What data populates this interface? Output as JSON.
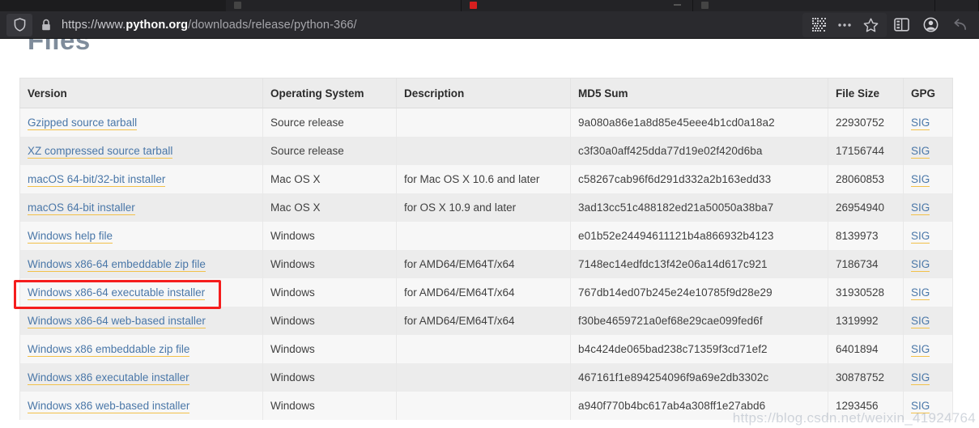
{
  "browser": {
    "url_full": "https://www.python.org/downloads/release/python-366/",
    "url_scheme": "https://www.",
    "url_host_bold": "python.org",
    "url_path": "/downloads/release/python-366/",
    "icons": {
      "shield": "shield-icon",
      "lock": "lock-icon",
      "qr": "qr-code-icon",
      "more": "ellipsis-icon",
      "bookmark": "star-icon",
      "sidebar": "sidebar-panel-icon",
      "account": "account-circle-icon",
      "back": "back-arrow-icon"
    }
  },
  "page": {
    "heading": "Files",
    "watermark": "https://blog.csdn.net/weixin_41924764"
  },
  "table": {
    "columns": [
      "Version",
      "Operating System",
      "Description",
      "MD5 Sum",
      "File Size",
      "GPG"
    ],
    "gpg_label": "SIG",
    "rows": [
      {
        "version": "Gzipped source tarball",
        "os": "Source release",
        "description": "",
        "md5": "9a080a86e1a8d85e45eee4b1cd0a18a2",
        "size": "22930752",
        "gpg": "SIG"
      },
      {
        "version": "XZ compressed source tarball",
        "os": "Source release",
        "description": "",
        "md5": "c3f30a0aff425dda77d19e02f420d6ba",
        "size": "17156744",
        "gpg": "SIG"
      },
      {
        "version": "macOS 64-bit/32-bit installer",
        "os": "Mac OS X",
        "description": "for Mac OS X 10.6 and later",
        "md5": "c58267cab96f6d291d332a2b163edd33",
        "size": "28060853",
        "gpg": "SIG"
      },
      {
        "version": "macOS 64-bit installer",
        "os": "Mac OS X",
        "description": "for OS X 10.9 and later",
        "md5": "3ad13cc51c488182ed21a50050a38ba7",
        "size": "26954940",
        "gpg": "SIG"
      },
      {
        "version": "Windows help file",
        "os": "Windows",
        "description": "",
        "md5": "e01b52e24494611121b4a866932b4123",
        "size": "8139973",
        "gpg": "SIG"
      },
      {
        "version": "Windows x86-64 embeddable zip file",
        "os": "Windows",
        "description": "for AMD64/EM64T/x64",
        "md5": "7148ec14edfdc13f42e06a14d617c921",
        "size": "7186734",
        "gpg": "SIG"
      },
      {
        "version": "Windows x86-64 executable installer",
        "os": "Windows",
        "description": "for AMD64/EM64T/x64",
        "md5": "767db14ed07b245e24e10785f9d28e29",
        "size": "31930528",
        "gpg": "SIG"
      },
      {
        "version": "Windows x86-64 web-based installer",
        "os": "Windows",
        "description": "for AMD64/EM64T/x64",
        "md5": "f30be4659721a0ef68e29cae099fed6f",
        "size": "1319992",
        "gpg": "SIG"
      },
      {
        "version": "Windows x86 embeddable zip file",
        "os": "Windows",
        "description": "",
        "md5": "b4c424de065bad238c71359f3cd71ef2",
        "size": "6401894",
        "gpg": "SIG"
      },
      {
        "version": "Windows x86 executable installer",
        "os": "Windows",
        "description": "",
        "md5": "467161f1e894254096f9a69e2db3302c",
        "size": "30878752",
        "gpg": "SIG"
      },
      {
        "version": "Windows x86 web-based installer",
        "os": "Windows",
        "description": "",
        "md5": "a940f770b4bc617ab4a308ff1e27abd6",
        "size": "1293456",
        "gpg": "SIG"
      }
    ]
  },
  "annotation": {
    "highlighted_row_version": "Windows x86-64 executable installer",
    "box_color": "#f51d1d"
  }
}
